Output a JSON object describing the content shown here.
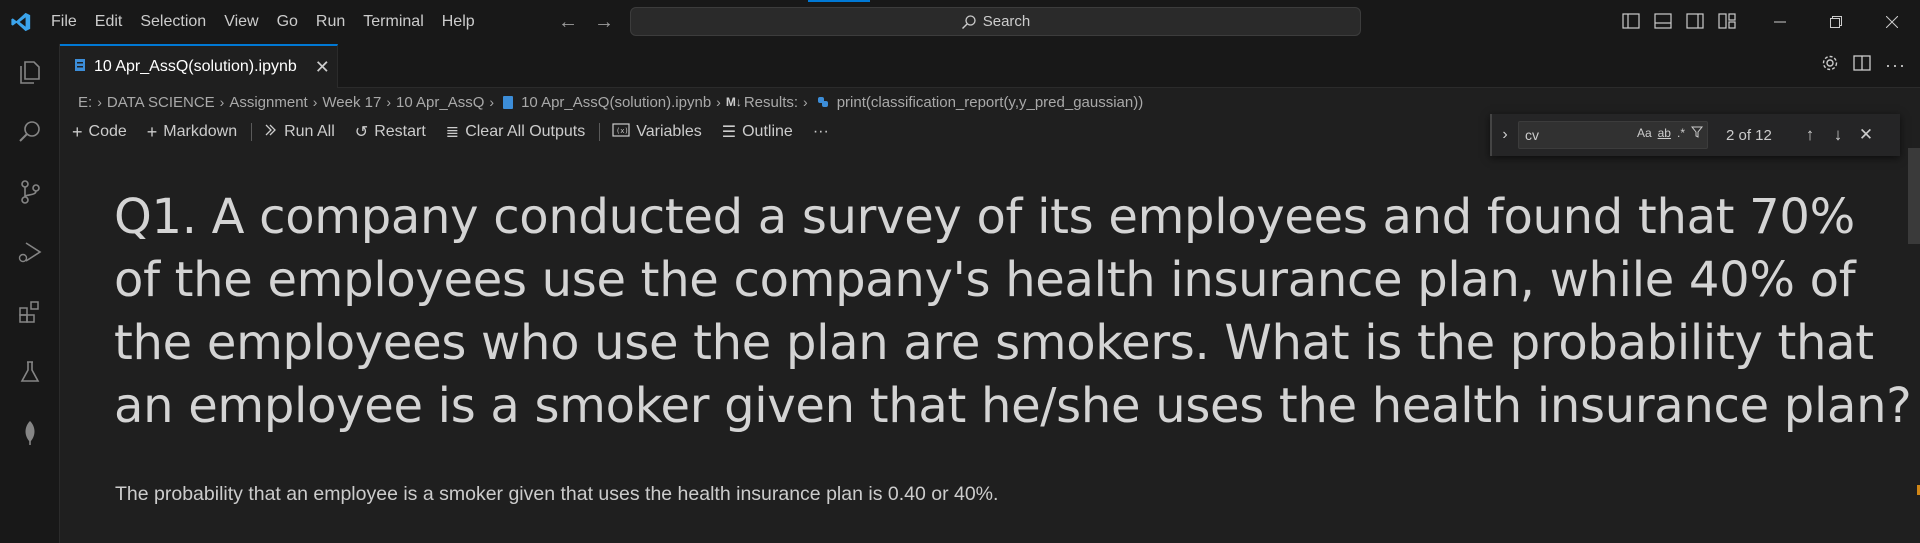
{
  "menu": [
    "File",
    "Edit",
    "Selection",
    "View",
    "Go",
    "Run",
    "Terminal",
    "Help"
  ],
  "search": {
    "label": "Search"
  },
  "tab": {
    "label": "10 Apr_AssQ(solution).ipynb",
    "close": "✕"
  },
  "breadcrumb": {
    "items": [
      "E:",
      "DATA SCIENCE",
      "Assignment",
      "Week 17",
      "10 Apr_AssQ",
      "10 Apr_AssQ(solution).ipynb",
      "Results:",
      "print(classification_report(y,y_pred_gaussian))"
    ],
    "md_badge": "M↓"
  },
  "toolbar": {
    "code": "Code",
    "markdown": "Markdown",
    "run_all": "Run All",
    "restart": "Restart",
    "clear_outputs": "Clear All Outputs",
    "variables": "Variables",
    "outline": "Outline",
    "more": "···"
  },
  "find": {
    "value": "cv",
    "match_case": "Aa",
    "whole_word": "ab",
    "regex": ".*",
    "count": "2 of 12"
  },
  "content": {
    "heading": "Q1. A company conducted a survey of its employees and found that 70% of the employees use the company's health insurance plan, while 40% of the employees who use the plan are smokers. What is the probability that an employee is a smoker given that he/she uses the health insurance plan?",
    "answer": "The probability that an employee is a smoker given that uses the health insurance plan is 0.40 or 40%."
  },
  "colors": {
    "accent": "#0078d4",
    "background": "#1f1f1f",
    "chrome": "#181818"
  }
}
